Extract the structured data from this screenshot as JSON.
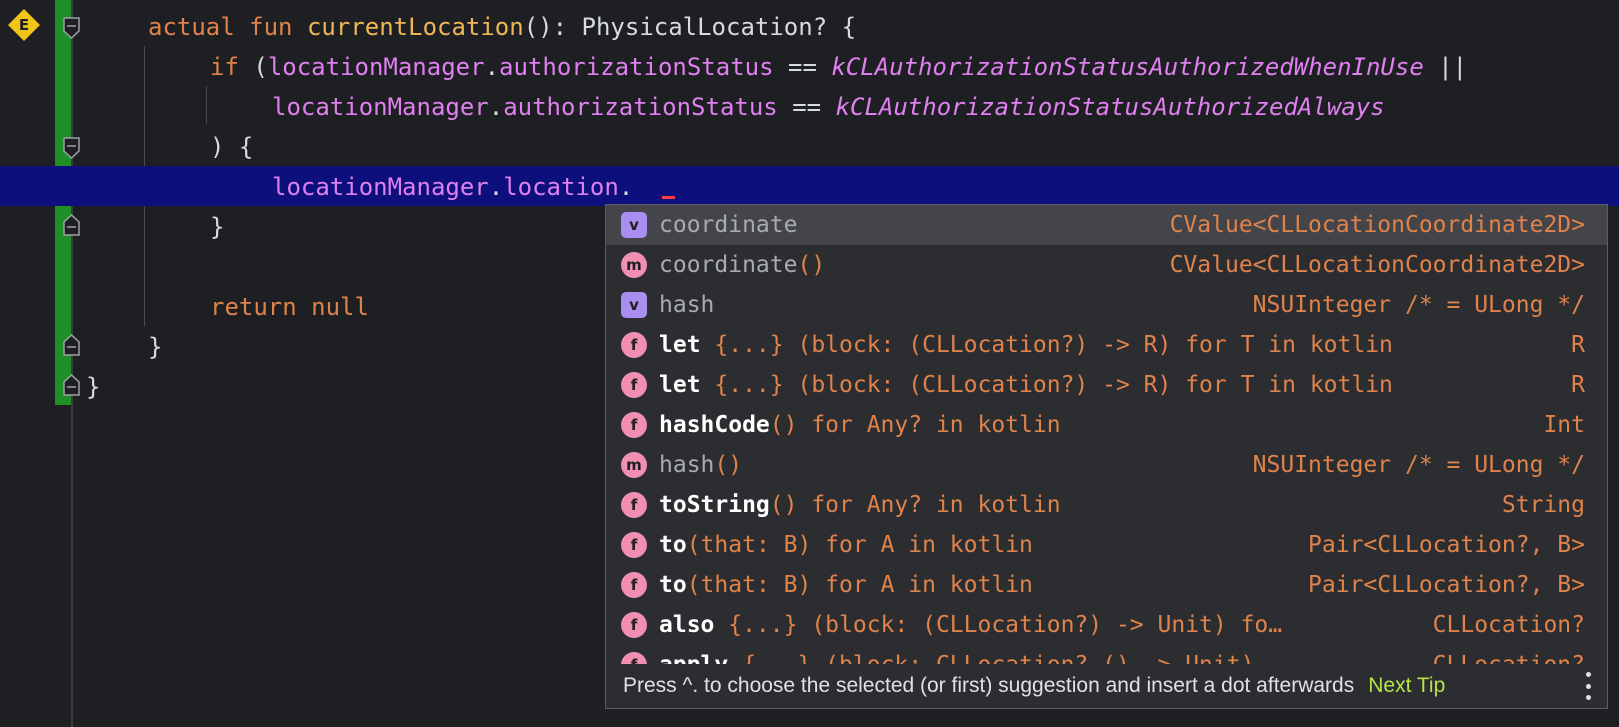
{
  "gutter": {
    "badge": "E"
  },
  "code": {
    "line1": {
      "kw1": "actual",
      "kw2": "fun",
      "name": "currentLocation",
      "rest": "(): PhysicalLocation? {"
    },
    "line2": {
      "kw": "if",
      "p1": " (",
      "obj": "locationManager",
      "dot": ".",
      "prop": "authorizationStatus",
      "op": " == ",
      "const": "kCLAuthorizationStatusAuthorizedWhenInUse",
      "end": " ||"
    },
    "line3": {
      "obj": "locationManager",
      "dot": ".",
      "prop": "authorizationStatus",
      "op": " == ",
      "const": "kCLAuthorizationStatusAuthorizedAlways"
    },
    "line4": {
      "text": ") {"
    },
    "line5": {
      "obj": "locationManager",
      "dot1": ".",
      "prop": "location",
      "dot2": "."
    },
    "line6": {
      "text": "}"
    },
    "line7": {
      "kw1": "return",
      "kw2": " null"
    },
    "line8": {
      "text": "}"
    },
    "line9": {
      "text": "}"
    }
  },
  "completion": {
    "items": [
      {
        "icon": "v",
        "name": "coordinate",
        "tail": "",
        "type": "CValue<CLLocationCoordinate2D>",
        "dim": true
      },
      {
        "icon": "m",
        "name": "coordinate",
        "tail": "()",
        "type": "CValue<CLLocationCoordinate2D>",
        "dim": true
      },
      {
        "icon": "v",
        "name": "hash",
        "tail": "",
        "type": "NSUInteger /* = ULong */",
        "dim": true
      },
      {
        "icon": "f",
        "name": "let",
        "tail": " {...} (block: (CLLocation?) -> R) for T in kotlin",
        "type": "R",
        "dim": false
      },
      {
        "icon": "f",
        "name": "let",
        "tail": " {...} (block: (CLLocation?) -> R) for T in kotlin",
        "type": "R",
        "dim": false
      },
      {
        "icon": "f",
        "name": "hashCode",
        "tail": "() for Any? in kotlin",
        "type": "Int",
        "dim": false
      },
      {
        "icon": "m",
        "name": "hash",
        "tail": "()",
        "type": "NSUInteger /* = ULong */",
        "dim": true
      },
      {
        "icon": "f",
        "name": "toString",
        "tail": "() for Any? in kotlin",
        "type": "String",
        "dim": false
      },
      {
        "icon": "f",
        "name": "to",
        "tail": "(that: B) for A in kotlin",
        "type": "Pair<CLLocation?, B>",
        "dim": false
      },
      {
        "icon": "f",
        "name": "to",
        "tail": "(that: B) for A in kotlin",
        "type": "Pair<CLLocation?, B>",
        "dim": false
      },
      {
        "icon": "f",
        "name": "also",
        "tail": " {...} (block: (CLLocation?) -> Unit) fo…",
        "type": "CLLocation?",
        "dim": false
      },
      {
        "icon": "f",
        "name": "apply",
        "tail": " {...} (block: CLLocation?.() -> Unit)",
        "type": "CLLocation?",
        "dim": false
      }
    ],
    "footer": {
      "hint": "Press ^. to choose the selected (or first) suggestion and insert a dot afterwards",
      "next_tip": "Next Tip"
    }
  }
}
